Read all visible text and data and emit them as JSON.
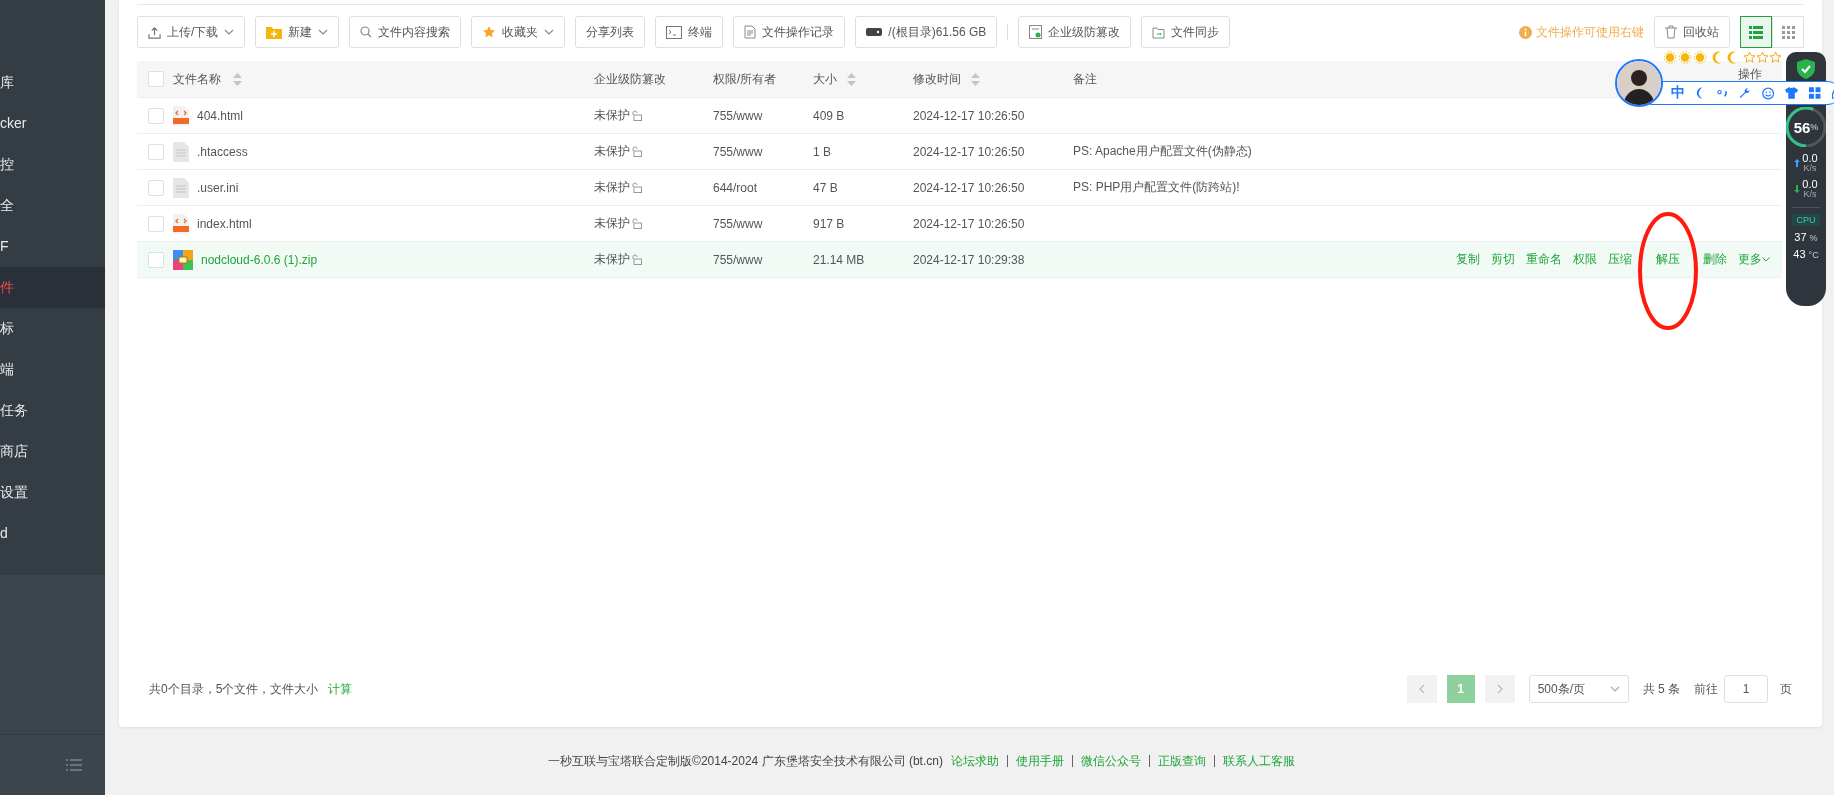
{
  "sidebar": {
    "items": [
      {
        "label": "库",
        "selected": false
      },
      {
        "label": "cker",
        "selected": false
      },
      {
        "label": "控",
        "selected": false
      },
      {
        "label": "全",
        "selected": false
      },
      {
        "label": "F",
        "selected": false
      },
      {
        "label": "件",
        "selected": true
      },
      {
        "label": "标",
        "selected": false
      },
      {
        "label": "端",
        "selected": false
      },
      {
        "label": "任务",
        "selected": false
      },
      {
        "label": "商店",
        "selected": false
      },
      {
        "label": "设置",
        "selected": false
      },
      {
        "label": "d",
        "selected": false
      }
    ]
  },
  "toolbar": {
    "buttons": [
      {
        "label": "上传/下载",
        "kind": "dropdown"
      },
      {
        "label": "新建",
        "kind": "dropdown"
      },
      {
        "label": "文件内容搜索",
        "kind": "button"
      },
      {
        "label": "收藏夹",
        "kind": "dropdown"
      },
      {
        "label": "分享列表",
        "kind": "button"
      },
      {
        "label": "终端",
        "kind": "button"
      },
      {
        "label": "文件操作记录",
        "kind": "button"
      },
      {
        "label": "/(根目录)61.56 GB",
        "kind": "button"
      },
      {
        "label": "企业级防篡改",
        "kind": "button"
      },
      {
        "label": "文件同步",
        "kind": "button"
      }
    ],
    "tip": "文件操作可使用右键",
    "recycle": "回收站",
    "views": [
      {
        "kind": "list",
        "selected": true
      },
      {
        "kind": "grid",
        "selected": false
      }
    ]
  },
  "table": {
    "select_all": {
      "checked": false
    },
    "columns": [
      {
        "label": "文件名称",
        "sortable": true
      },
      {
        "label": "企业级防篡改",
        "sortable": false
      },
      {
        "label": "权限/所有者",
        "sortable": false
      },
      {
        "label": "大小",
        "sortable": true
      },
      {
        "label": "修改时间",
        "sortable": true
      },
      {
        "label": "备注",
        "sortable": false
      },
      {
        "label": "操作",
        "sortable": false
      }
    ],
    "rows": [
      {
        "name": "404.html",
        "kind": "html",
        "protection": "未保护",
        "permission": "755/www",
        "size": "409 B",
        "modified": "2024-12-17 10:26:50",
        "note": "",
        "hovered": false,
        "checked": false
      },
      {
        "name": ".htaccess",
        "kind": "text",
        "protection": "未保护",
        "permission": "755/www",
        "size": "1 B",
        "modified": "2024-12-17 10:26:50",
        "note": "PS: Apache用户配置文件(伪静态)",
        "hovered": false,
        "checked": false
      },
      {
        "name": ".user.ini",
        "kind": "text",
        "protection": "未保护",
        "permission": "644/root",
        "size": "47 B",
        "modified": "2024-12-17 10:26:50",
        "note": "PS: PHP用户配置文件(防跨站)!",
        "hovered": false,
        "checked": false
      },
      {
        "name": "index.html",
        "kind": "html",
        "protection": "未保护",
        "permission": "755/www",
        "size": "917 B",
        "modified": "2024-12-17 10:26:50",
        "note": "",
        "hovered": false,
        "checked": false
      },
      {
        "name": "nodcloud-6.0.6 (1).zip",
        "kind": "zip",
        "protection": "未保护",
        "permission": "755/www",
        "size": "21.14 MB",
        "modified": "2024-12-17 10:29:38",
        "note": "",
        "hovered": true,
        "checked": false
      }
    ],
    "row_actions": [
      "复制",
      "剪切",
      "重命名",
      "权限",
      "压缩",
      "解压",
      "删除",
      "更多"
    ]
  },
  "summary": {
    "text": "共0个目录，5个文件，文件大小",
    "link": "计算"
  },
  "pagination": {
    "pages": [
      {
        "label": "1",
        "selected": true
      }
    ],
    "page_size": "500条/页",
    "total": "共 5 条",
    "goto_label": "前往",
    "goto_value": "1",
    "goto_unit": "页"
  },
  "footer": {
    "text": "一秒互联与宝塔联合定制版©2014-2024 广东堡塔安全技术有限公司 (bt.cn)",
    "links": [
      "论坛求助",
      "使用手册",
      "微信公众号",
      "正版查询",
      "联系人工客服"
    ]
  },
  "ime_bar": {
    "label": "中"
  },
  "monitor": {
    "percent": "56",
    "percent_unit": "%",
    "upload": "0.0",
    "upload_unit": "K/s",
    "download": "0.0",
    "download_unit": "K/s",
    "cpu_label": "CPU",
    "cpu": "37",
    "cpu_unit": "%",
    "temp": "43",
    "temp_unit": "°C"
  }
}
